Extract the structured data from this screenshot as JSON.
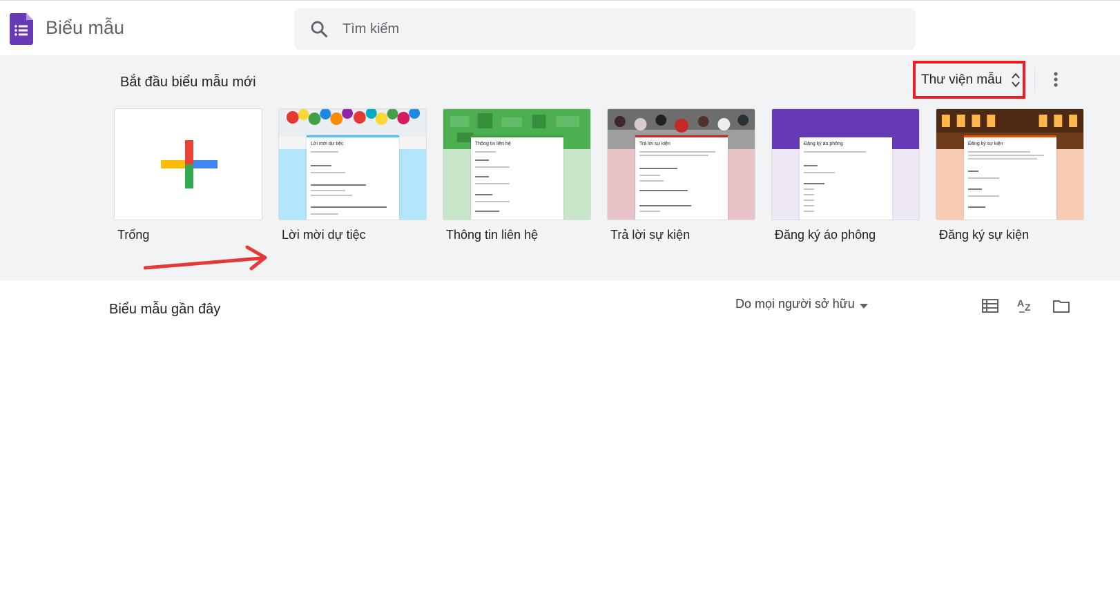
{
  "header": {
    "app_title": "Biểu mẫu",
    "search_placeholder": "Tìm kiếm"
  },
  "template_section": {
    "title": "Bắt đầu biểu mẫu mới",
    "gallery_label": "Thư viện mẫu",
    "templates": [
      {
        "label": "Trống"
      },
      {
        "label": "Lời mời dự tiệc",
        "form_title": "Lời mời dự tiệc",
        "accent": "#4fc3f7",
        "bg": "#b3e5fc"
      },
      {
        "label": "Thông tin liên hệ",
        "form_title": "Thông tin liên hệ",
        "accent": "#43a047",
        "bg": "#c8e6c9"
      },
      {
        "label": "Trả lời sự kiện",
        "form_title": "Trả lời sự kiện",
        "accent": "#c62828",
        "bg": "#e8c4c8"
      },
      {
        "label": "Đăng ký áo phông",
        "form_title": "Đăng ký áo phông",
        "accent": "#673ab7",
        "bg": "#ede7f6"
      },
      {
        "label": "Đăng ký sự kiện",
        "form_title": "Đăng ký sự kiện",
        "accent": "#e65100",
        "bg": "#f8cbb5"
      }
    ]
  },
  "recent_section": {
    "title": "Biểu mẫu gần đây",
    "owner_filter": "Do mọi người sở hữu"
  },
  "colors": {
    "brand": "#673ab7",
    "highlight_box": "#ee1c25",
    "annotation_arrow": "#e53935"
  },
  "icons": [
    "forms-logo-icon",
    "search-icon",
    "unfold-icon",
    "more-vert-icon",
    "caret-down-icon",
    "list-view-icon",
    "sort-az-icon",
    "folder-icon"
  ]
}
